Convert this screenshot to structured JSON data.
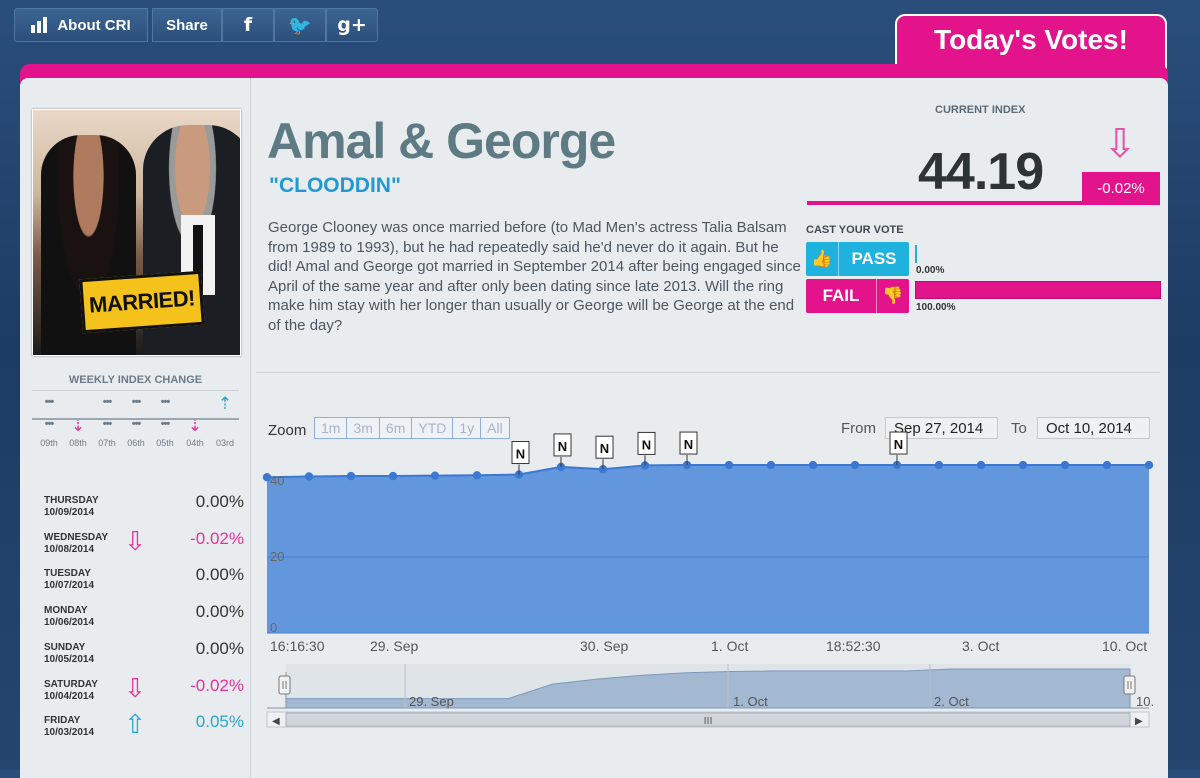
{
  "topbar": {
    "about_label": "About CRI",
    "share_label": "Share",
    "facebook_icon": "f",
    "twitter_icon": "🐦",
    "gplus_icon": "g+"
  },
  "today_tab": "Today's Votes!",
  "couple": {
    "title": "Amal & George",
    "nickname": "\"CLOODDIN\"",
    "photo_badge": "MARRIED!",
    "description": "George Clooney was once married before (to Mad Men's actress Talia Balsam from 1989 to 1993), but he had repeatedly said he'd never do it again. But he did! Amal and George got married in September 2014 after being engaged since April of the same year and after only been dating since late 2013. Will the ring make him stay with her longer than usually or George will be George at the end of the day?"
  },
  "index": {
    "label": "CURRENT INDEX",
    "value": "44.19",
    "change": "-0.02%"
  },
  "vote": {
    "label": "CAST YOUR VOTE",
    "pass_label": "PASS",
    "fail_label": "FAIL",
    "pass_pct": "0.00%",
    "fail_pct": "100.00%",
    "pass_fraction": 0.0,
    "fail_fraction": 1.0
  },
  "weekly": {
    "title": "WEEKLY INDEX CHANGE",
    "weeks": [
      {
        "label": "09th",
        "dir": "flat"
      },
      {
        "label": "08th",
        "dir": "down"
      },
      {
        "label": "07th",
        "dir": "flat"
      },
      {
        "label": "06th",
        "dir": "flat"
      },
      {
        "label": "05th",
        "dir": "flat"
      },
      {
        "label": "04th",
        "dir": "down"
      },
      {
        "label": "03rd",
        "dir": "up"
      }
    ]
  },
  "daily": [
    {
      "day": "THURSDAY",
      "date": "10/09/2014",
      "value": "0.00%",
      "dir": "flat"
    },
    {
      "day": "WEDNESDAY",
      "date": "10/08/2014",
      "value": "-0.02%",
      "dir": "down"
    },
    {
      "day": "TUESDAY",
      "date": "10/07/2014",
      "value": "0.00%",
      "dir": "flat"
    },
    {
      "day": "MONDAY",
      "date": "10/06/2014",
      "value": "0.00%",
      "dir": "flat"
    },
    {
      "day": "SUNDAY",
      "date": "10/05/2014",
      "value": "0.00%",
      "dir": "flat"
    },
    {
      "day": "SATURDAY",
      "date": "10/04/2014",
      "value": "-0.02%",
      "dir": "down"
    },
    {
      "day": "FRIDAY",
      "date": "10/03/2014",
      "value": "0.05%",
      "dir": "up"
    }
  ],
  "chart_controls": {
    "zoom_label": "Zoom",
    "zoom_buttons": [
      "1m",
      "3m",
      "6m",
      "YTD",
      "1y",
      "All"
    ],
    "from_label": "From",
    "from_value": "Sep 27, 2014",
    "to_label": "To",
    "to_value": "Oct 10, 2014"
  },
  "colors": {
    "brand_pink": "#e3138b",
    "pass_blue": "#1fb2de",
    "chart_fill": "#5f95dd",
    "chart_line": "#3b78d2"
  },
  "chart_data": {
    "type": "area",
    "y_ticks": [
      "0",
      "20",
      "40"
    ],
    "ylim": [
      0,
      45
    ],
    "x_tick_labels": [
      "16:16:30",
      "29. Sep",
      "30. Sep",
      "1. Oct",
      "18:52:30",
      "3. Oct",
      "10. Oct"
    ],
    "series": [
      {
        "values": [
          41,
          41.2,
          41.3,
          41.3,
          41.4,
          41.5,
          41.7,
          43.7,
          43.1,
          44.1,
          44.2,
          44.2,
          44.2,
          44.2,
          44.2,
          44.2,
          44.2,
          44.2,
          44.2,
          44.2,
          44.2,
          44.2
        ]
      }
    ],
    "flags": [
      {
        "point": 6,
        "label": "N"
      },
      {
        "point": 7,
        "label": "N"
      },
      {
        "point": 8,
        "label": "N"
      },
      {
        "point": 9,
        "label": "N"
      },
      {
        "point": 10,
        "label": "N"
      },
      {
        "point": 15,
        "label": "N"
      }
    ],
    "navigator_labels": [
      "29. Sep",
      "1. Oct",
      "2. Oct",
      "10."
    ],
    "navigator_values": [
      39.5,
      39.5,
      39.5,
      39.5,
      39.5,
      39.5,
      41.8,
      42.6,
      43.2,
      43.6,
      43.8,
      43.9,
      43.9,
      43.9,
      43.9,
      44.2,
      44.2,
      44.2,
      44.2,
      44.2
    ],
    "navigator_range": [
      38,
      45
    ]
  }
}
